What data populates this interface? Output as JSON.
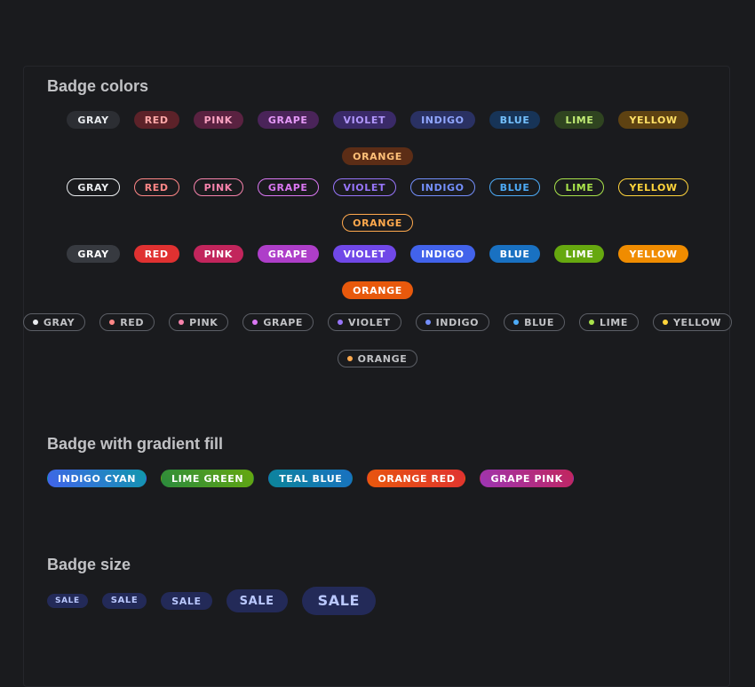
{
  "sections": {
    "colors_title": "Badge colors",
    "gradient_title": "Badge with gradient fill",
    "size_title": "Badge size"
  },
  "colors": [
    {
      "key": "gray",
      "label": "GRAY",
      "light_bg": "#2c2e33",
      "light_fg": "#e9ecef",
      "outline": "#e9ecef",
      "filled": "#373a40",
      "dot": "#e9ecef"
    },
    {
      "key": "red",
      "label": "RED",
      "light_bg": "#5c2229",
      "light_fg": "#ffa8a8",
      "outline": "#ff8787",
      "filled": "#e03131",
      "dot": "#ff8787"
    },
    {
      "key": "pink",
      "label": "PINK",
      "light_bg": "#5a2241",
      "light_fg": "#faa2c1",
      "outline": "#f783ac",
      "filled": "#c2255c",
      "dot": "#f783ac"
    },
    {
      "key": "grape",
      "label": "GRAPE",
      "light_bg": "#4a2459",
      "light_fg": "#e599f7",
      "outline": "#da77f2",
      "filled": "#ae3ec9",
      "dot": "#da77f2"
    },
    {
      "key": "violet",
      "label": "VIOLET",
      "light_bg": "#3a2a68",
      "light_fg": "#b197fc",
      "outline": "#9775fa",
      "filled": "#7048e8",
      "dot": "#9775fa"
    },
    {
      "key": "indigo",
      "label": "INDIGO",
      "light_bg": "#2a3163",
      "light_fg": "#91a7ff",
      "outline": "#748ffc",
      "filled": "#4263eb",
      "dot": "#748ffc"
    },
    {
      "key": "blue",
      "label": "BLUE",
      "light_bg": "#173457",
      "light_fg": "#74c0fc",
      "outline": "#4dabf7",
      "filled": "#1971c2",
      "dot": "#4dabf7"
    },
    {
      "key": "lime",
      "label": "LIME",
      "light_bg": "#2f4420",
      "light_fg": "#c0eb75",
      "outline": "#a9e34b",
      "filled": "#66a80f",
      "dot": "#a9e34b"
    },
    {
      "key": "yellow",
      "label": "YELLOW",
      "light_bg": "#5e4212",
      "light_fg": "#ffe066",
      "outline": "#ffd43b",
      "filled": "#f08c00",
      "dot": "#ffd43b"
    },
    {
      "key": "orange",
      "label": "ORANGE",
      "light_bg": "#5c2d16",
      "light_fg": "#ffc078",
      "outline": "#ffa94d",
      "filled": "#e8590c",
      "dot": "#ffa94d"
    }
  ],
  "gradients": [
    {
      "label": "INDIGO CYAN",
      "from": "#4263eb",
      "to": "#1098ad"
    },
    {
      "label": "LIME GREEN",
      "from": "#2b8a3e",
      "to": "#66a80f"
    },
    {
      "label": "TEAL BLUE",
      "from": "#0c8599",
      "to": "#1971c2"
    },
    {
      "label": "ORANGE RED",
      "from": "#e8590c",
      "to": "#e03131"
    },
    {
      "label": "GRAPE PINK",
      "from": "#9c36b5",
      "to": "#c2255c"
    }
  ],
  "sizes": [
    {
      "label": "SALE",
      "size": "xs"
    },
    {
      "label": "SALE",
      "size": "sm"
    },
    {
      "label": "SALE",
      "size": "md"
    },
    {
      "label": "SALE",
      "size": "lg"
    },
    {
      "label": "SALE",
      "size": "xl"
    }
  ]
}
